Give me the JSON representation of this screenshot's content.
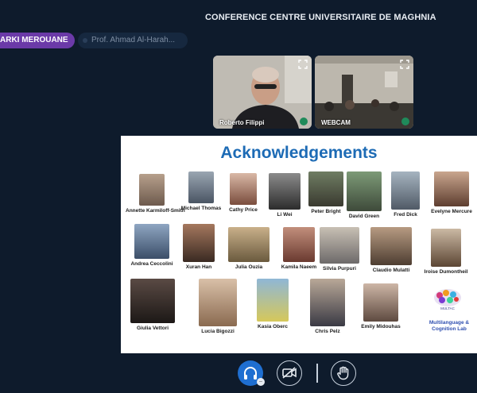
{
  "meeting": {
    "title": "CONFERENCE CENTRE UNIVERSITAIRE DE MAGHNIA"
  },
  "presenter": {
    "name": "ARKI MEROUANE"
  },
  "participant_list": {
    "name": "Prof. Ahmad Al-Harah..."
  },
  "video_tiles": [
    {
      "name": "Roberto Filippi"
    },
    {
      "name": "WEBCAM"
    }
  ],
  "slide": {
    "title": "Acknowledgements",
    "people": [
      "Annette Karmiloff-Smith",
      "Michael Thomas",
      "Cathy Price",
      "Li Wei",
      "Peter Bright",
      "David Green",
      "Fred Dick",
      "Evelyne Mercure",
      "Andrea Ceccolini",
      "Xuran Han",
      "Julia Ouzia",
      "Kamila Naeem",
      "Silvia Purpuri",
      "Claudio Mulatti",
      "Iroise Dumontheil",
      "Giulia Vettori",
      "Lucia Bigozzi",
      "Kasia Oberc",
      "Chris Pelz",
      "Emily Midouhas"
    ],
    "lab": {
      "logo_text": "MULTAC",
      "name": "Multilanguage & Cognition Lab"
    }
  },
  "controls": {
    "audio_icon": "headphones-icon",
    "video_icon": "video-off-icon",
    "hand_icon": "raise-hand-icon",
    "badge_icon": "minus-icon"
  },
  "colors": {
    "background": "#0e1b2c",
    "presenter_pill": "#6b3aa8",
    "slide_title": "#1d6bb5",
    "audio_button": "#1f6fd1",
    "lab_text": "#2f4fb0"
  }
}
